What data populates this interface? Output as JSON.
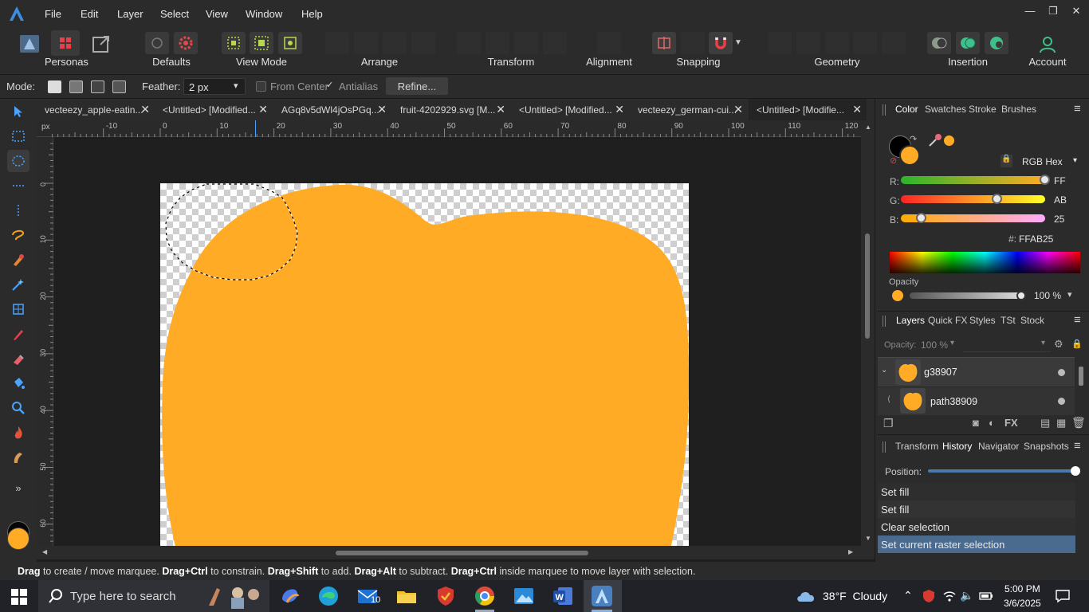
{
  "menubar": {
    "items": [
      "File",
      "Edit",
      "Layer",
      "Select",
      "View",
      "Window",
      "Help"
    ]
  },
  "toolbar": {
    "groups": [
      "Personas",
      "Defaults",
      "View Mode",
      "Arrange",
      "Transform",
      "Alignment",
      "Snapping",
      "Geometry",
      "Insertion",
      "Account"
    ]
  },
  "context": {
    "mode_label": "Mode:",
    "feather_label": "Feather:",
    "feather_value": "2 px",
    "from_center": "From Center",
    "antialias": "Antialias",
    "refine": "Refine..."
  },
  "tabs": [
    "vecteezy_apple-eatin...",
    "<Untitled> [Modified...",
    "AGq8v5dWl4jOsPGq...",
    "fruit-4202929.svg [M...",
    "<Untitled> [Modified...",
    "vecteezy_german-cui...",
    "<Untitled> [Modifie..."
  ],
  "ruler": {
    "unit": "px",
    "h_ticks": [
      "-10",
      "0",
      "10",
      "20",
      "30",
      "40",
      "50",
      "60",
      "70",
      "80",
      "90",
      "100",
      "110",
      "120"
    ],
    "v_ticks": [
      "0",
      "10",
      "20",
      "30",
      "40",
      "50",
      "60"
    ]
  },
  "colors": {
    "fill": "#FFAB25",
    "accent": "#4a6a8e"
  },
  "color_panel": {
    "tabs": [
      "Color",
      "Swatches",
      "Stroke",
      "Brushes"
    ],
    "model": "RGB Hex",
    "r_label": "R:",
    "r_value": "FF",
    "r_level": 1.0,
    "g_label": "G:",
    "g_value": "AB",
    "g_level": 0.671,
    "b_label": "B:",
    "b_value": "25",
    "b_level": 0.145,
    "hex_label": "#:",
    "hex_value": "FFAB25",
    "opacity_label": "Opacity",
    "opacity_value": "100 %"
  },
  "layers_panel": {
    "tabs": [
      "Layers",
      "Quick FX",
      "Styles",
      "TSt",
      "Stock"
    ],
    "opacity_label": "Opacity:",
    "opacity_value": "100 %",
    "layers": [
      "g38907",
      "path38909"
    ]
  },
  "history_panel": {
    "tabs": [
      "Transform",
      "History",
      "Navigator",
      "Snapshots"
    ],
    "position_label": "Position:",
    "entries": [
      "Set fill",
      "Set fill",
      "Clear selection",
      "Set current raster selection"
    ]
  },
  "status": {
    "parts": [
      {
        "b": "Drag",
        "t": " to create / move marquee. "
      },
      {
        "b": "Drag+Ctrl",
        "t": " to constrain. "
      },
      {
        "b": "Drag+Shift",
        "t": " to add. "
      },
      {
        "b": "Drag+Alt",
        "t": " to subtract. "
      },
      {
        "b": "Drag+Ctrl",
        "t": " inside marquee to move layer with selection."
      }
    ]
  },
  "taskbar": {
    "search_placeholder": "Type here to search",
    "mail_badge": "10",
    "weather": "38°F  Cloudy",
    "time": "5:00 PM",
    "date": "3/6/2025"
  }
}
